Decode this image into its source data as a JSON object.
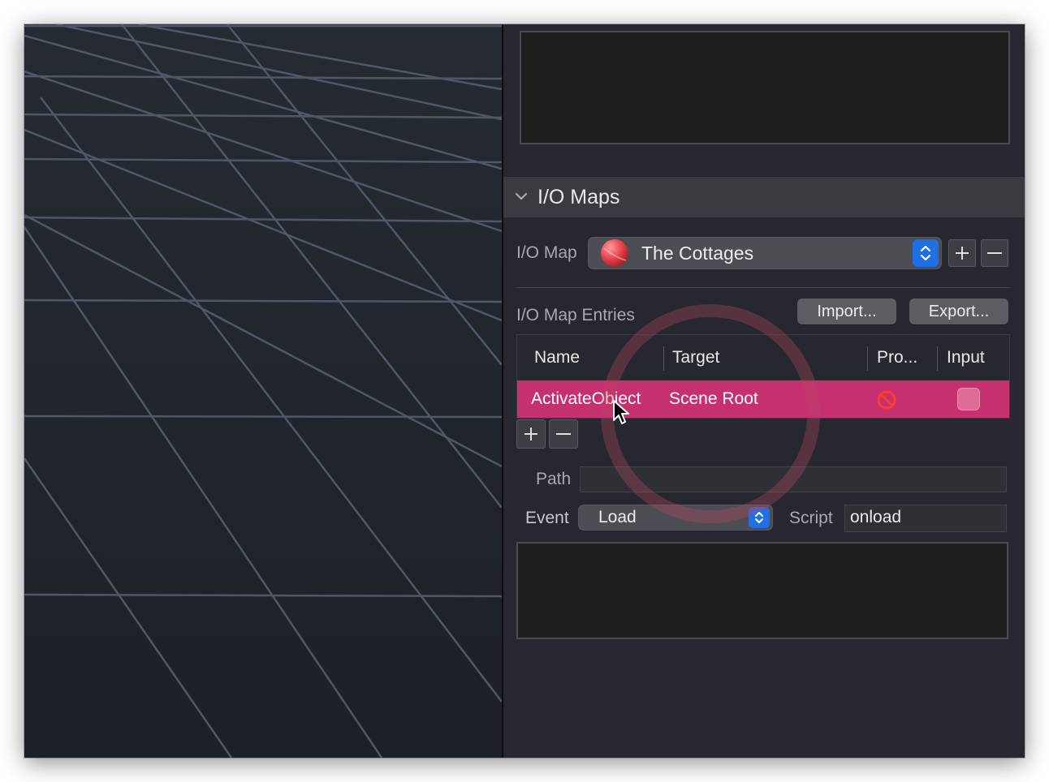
{
  "inspector": {
    "section": {
      "title": "I/O Maps"
    },
    "io_map": {
      "label": "I/O Map",
      "selected": "The Cottages",
      "add_label": "+",
      "remove_label": "—"
    },
    "entries": {
      "label": "I/O Map Entries",
      "import_label": "Import...",
      "export_label": "Export...",
      "columns": [
        "Name",
        "Target",
        "Pro...",
        "Input"
      ],
      "rows": [
        {
          "name": "ActivateObject",
          "target": "Scene Root",
          "pro_icon": "prohibited-icon",
          "input_checked": false
        }
      ],
      "add_label": "+",
      "remove_label": "—"
    },
    "path": {
      "label": "Path",
      "value": ""
    },
    "event": {
      "label": "Event",
      "selected": "Load"
    },
    "script": {
      "label": "Script",
      "value": "onload"
    }
  },
  "colors": {
    "selection": "#c5306f",
    "stepper": "#1f6fe5",
    "section_header": "#3a3b40"
  }
}
